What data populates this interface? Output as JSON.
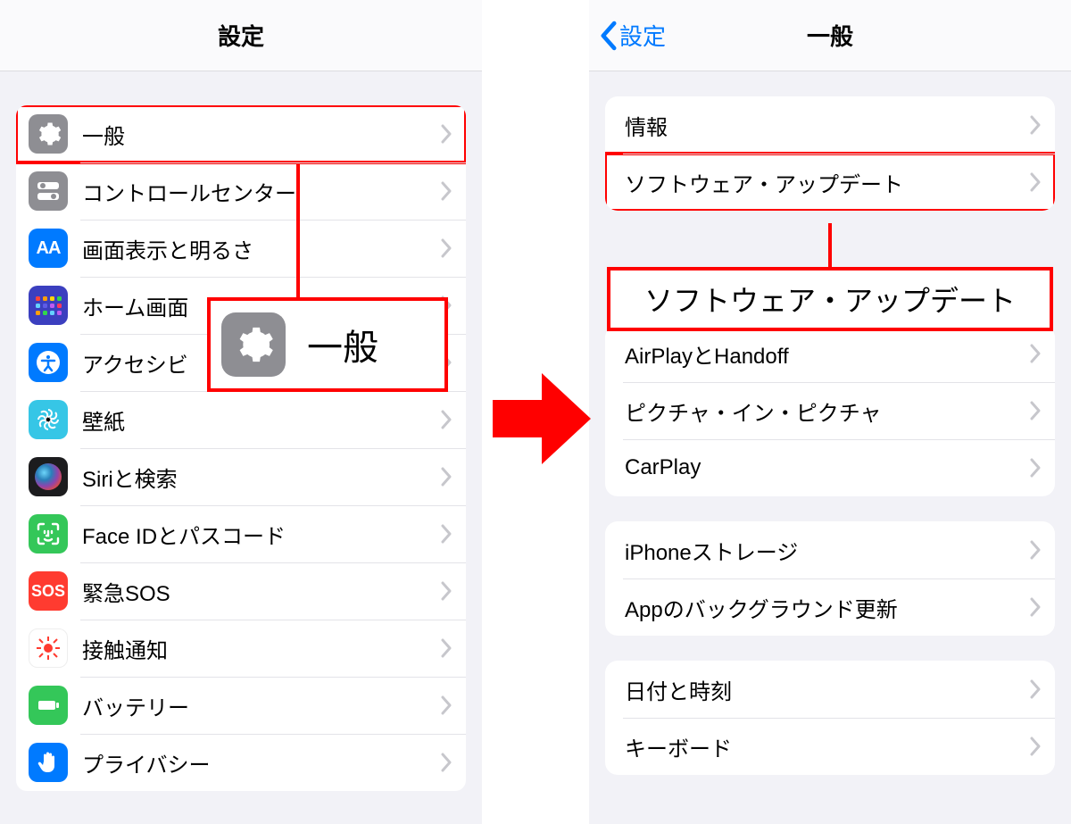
{
  "left": {
    "title": "設定",
    "rows": [
      {
        "label": "一般",
        "icon": "general"
      },
      {
        "label": "コントロールセンター",
        "icon": "control"
      },
      {
        "label": "画面表示と明るさ",
        "icon": "display"
      },
      {
        "label": "ホーム画面",
        "icon": "home"
      },
      {
        "label": "アクセシビ",
        "icon": "access"
      },
      {
        "label": "壁紙",
        "icon": "wallpaper"
      },
      {
        "label": "Siriと検索",
        "icon": "siri"
      },
      {
        "label": "Face IDとパスコード",
        "icon": "faceid"
      },
      {
        "label": "緊急SOS",
        "icon": "sos"
      },
      {
        "label": "接触通知",
        "icon": "exposure"
      },
      {
        "label": "バッテリー",
        "icon": "battery"
      },
      {
        "label": "プライバシー",
        "icon": "privacy"
      }
    ],
    "callout": "一般"
  },
  "right": {
    "title": "一般",
    "back": "設定",
    "groups": [
      [
        {
          "label": "情報"
        },
        {
          "label": "ソフトウェア・アップデート",
          "highlight": true
        }
      ],
      [
        {
          "label": "AirPlayとHandoff"
        },
        {
          "label": "ピクチャ・イン・ピクチャ"
        },
        {
          "label": "CarPlay"
        }
      ],
      [
        {
          "label": "iPhoneストレージ"
        },
        {
          "label": "Appのバックグラウンド更新"
        }
      ],
      [
        {
          "label": "日付と時刻"
        },
        {
          "label": "キーボード"
        }
      ]
    ],
    "callout": "ソフトウェア・アップデート"
  }
}
